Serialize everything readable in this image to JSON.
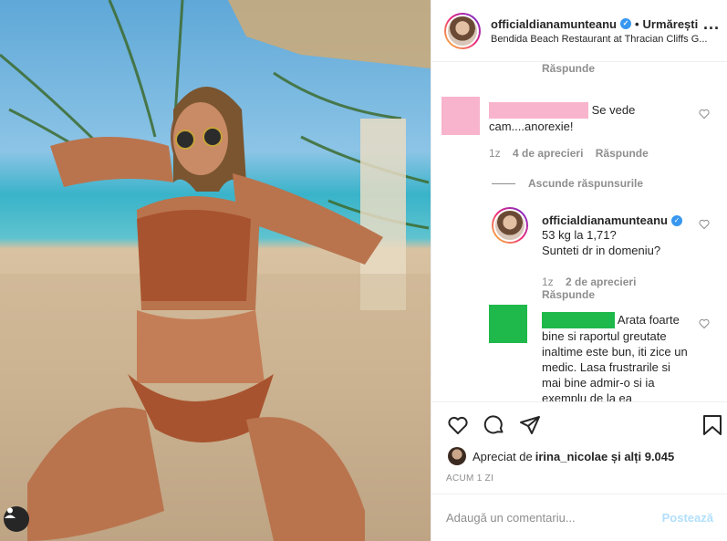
{
  "post": {
    "username": "officialdianamunteanu",
    "separator": "•",
    "follow_label": "Urmărești",
    "location": "Bendida Beach Restaurant at Thracian Cliffs G...",
    "more_label": "..."
  },
  "comments": {
    "top_reply_label": "Răspunde",
    "comment1": {
      "text": "Se vede cam....anorexie!",
      "time": "1z",
      "likes": "4 de aprecieri",
      "reply_label": "Răspunde"
    },
    "hide_replies_label": "Ascunde răspunsurile",
    "reply1": {
      "username": "officialdianamunteanu",
      "text_line1": "53 kg la 1,71?",
      "text_line2": "Sunteti dr in domeniu?",
      "time": "1z",
      "likes": "2 de aprecieri",
      "reply_label": "Răspunde"
    },
    "reply2": {
      "text": "Arata foarte bine si raportul greutate inaltime este bun, iti zice un medic. Lasa frustrarile si mai bine admir-o si ia exemplu de la ea"
    }
  },
  "actions": {
    "liked_by_prefix": "Apreciat de ",
    "liked_by_user": "irina_nicolae",
    "liked_by_suffix": " și alți 9.045",
    "timestamp": "ACUM 1 ZI"
  },
  "add_comment": {
    "placeholder": "Adaugă un comentariu...",
    "post_label": "Postează"
  },
  "colors": {
    "redact_pink": "#f8b4cc",
    "redact_green": "#1fb84a",
    "verified_blue": "#3897f0",
    "post_disabled": "#b2dffc"
  }
}
